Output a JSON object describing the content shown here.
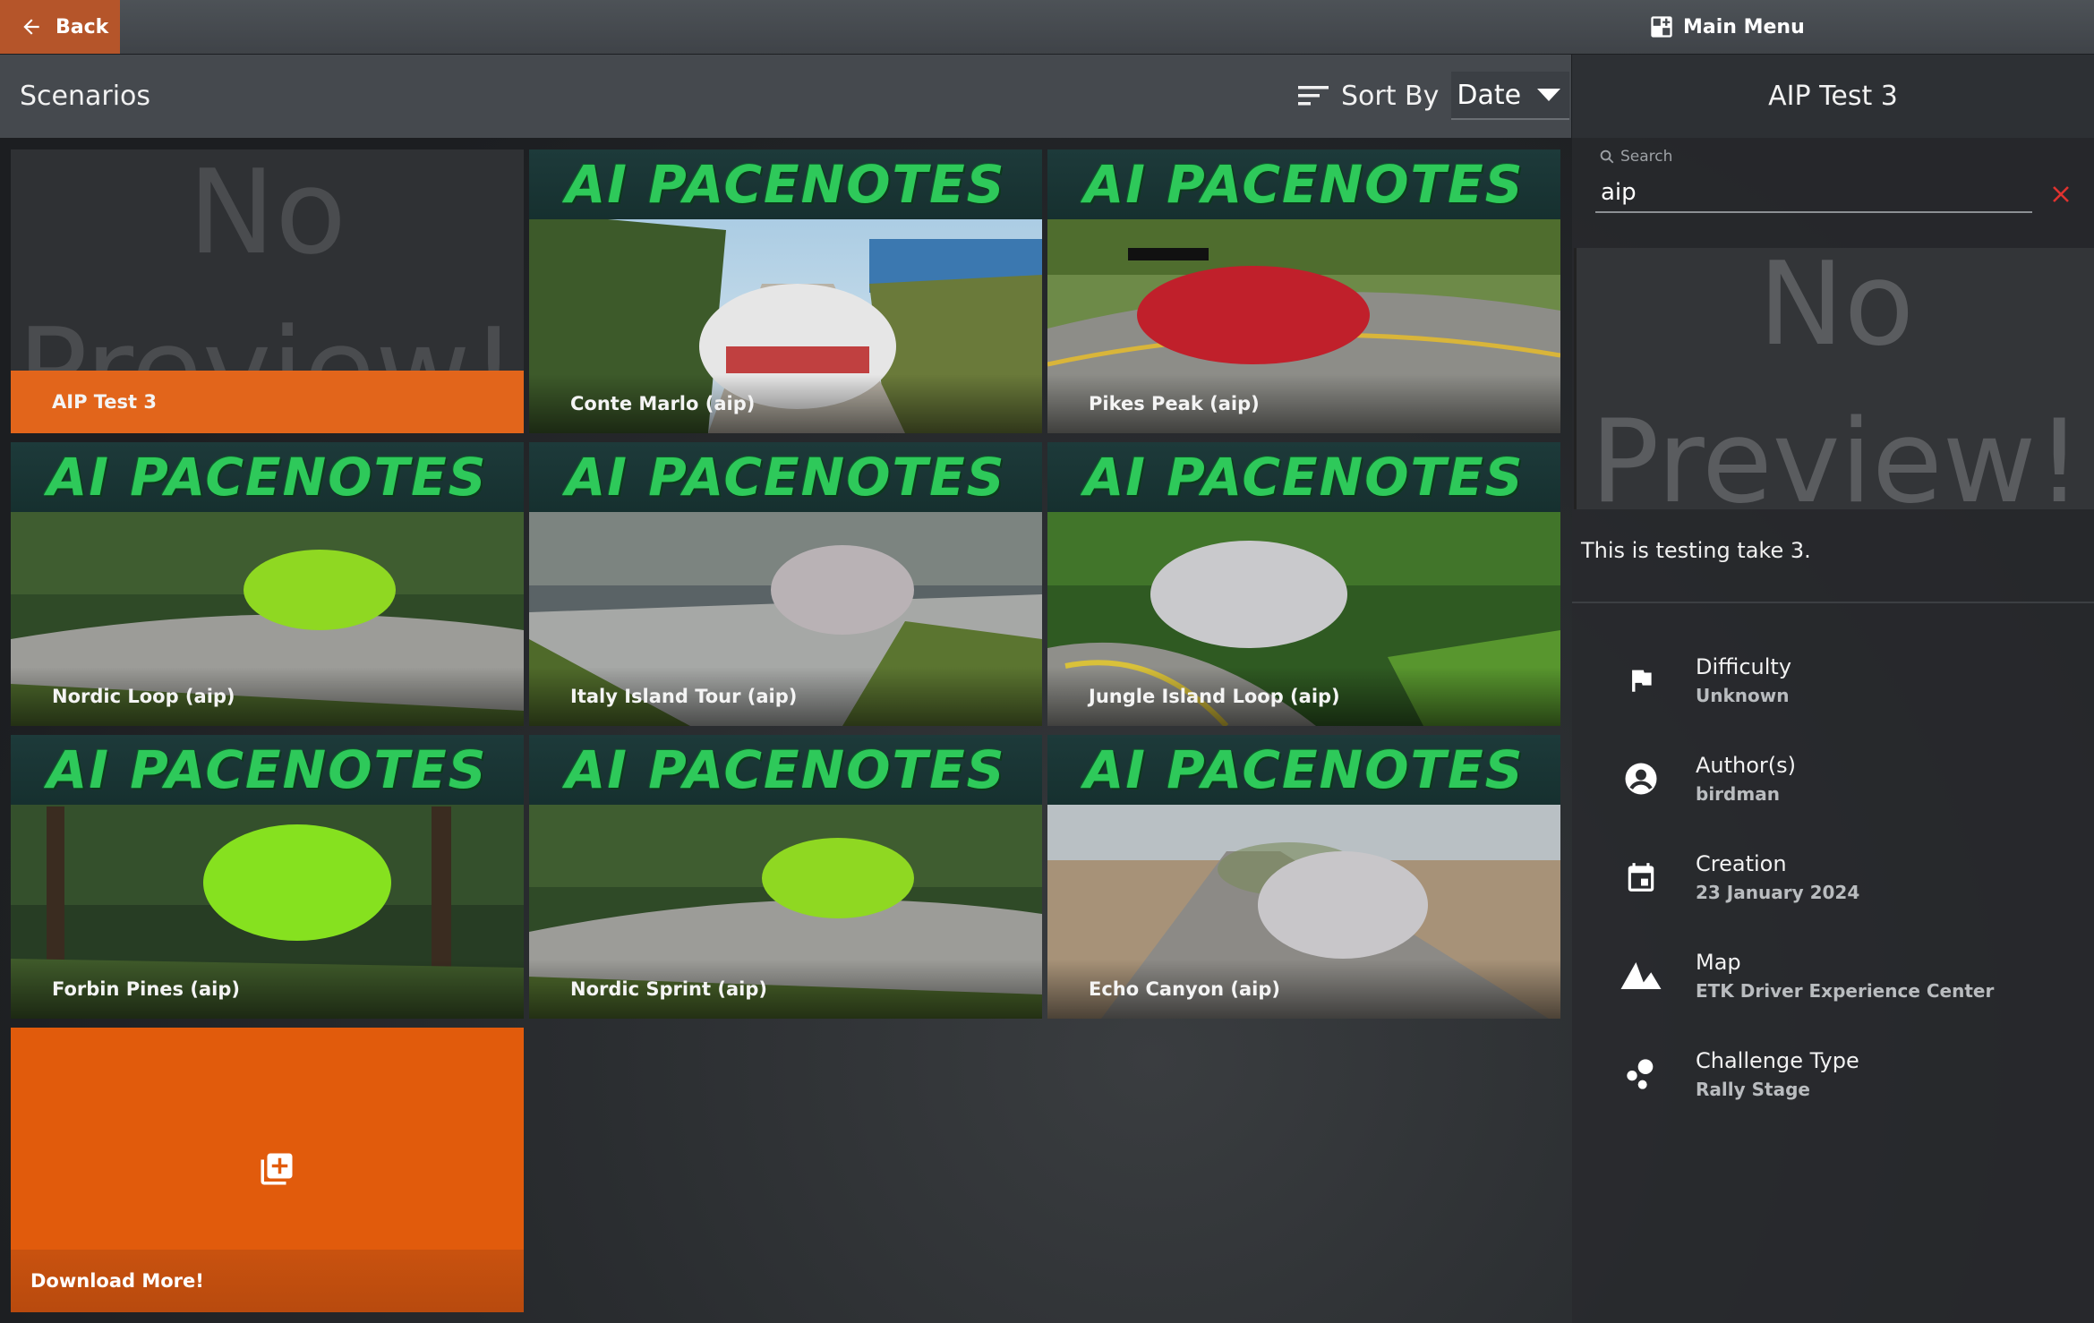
{
  "topbar": {
    "back_label": "Back",
    "main_menu_label": "Main Menu"
  },
  "header": {
    "title": "Scenarios",
    "sort_label": "Sort By",
    "sort_value": "Date"
  },
  "tiles": [
    {
      "label": "AIP Test 3",
      "banner": "",
      "nopreview_1": "No",
      "nopreview_2": "Preview!"
    },
    {
      "label": "Conte Marlo (aip)",
      "banner": "AI PACENOTES"
    },
    {
      "label": "Pikes Peak (aip)",
      "banner": "AI PACENOTES"
    },
    {
      "label": "Nordic Loop (aip)",
      "banner": "AI PACENOTES"
    },
    {
      "label": "Italy Island Tour (aip)",
      "banner": "AI PACENOTES"
    },
    {
      "label": "Jungle Island Loop (aip)",
      "banner": "AI PACENOTES"
    },
    {
      "label": "Forbin Pines (aip)",
      "banner": "AI PACENOTES"
    },
    {
      "label": "Nordic Sprint (aip)",
      "banner": "AI PACENOTES"
    },
    {
      "label": "Echo Canyon (aip)",
      "banner": "AI PACENOTES"
    }
  ],
  "download": {
    "label": "Download More!"
  },
  "panel": {
    "title": "AIP Test 3",
    "search_label": "Search",
    "search_value": "aip",
    "preview_1": "No",
    "preview_2": "Preview!",
    "description": "This is testing take 3.",
    "info": [
      {
        "key": "Difficulty",
        "value": "Unknown",
        "icon": "flag-icon"
      },
      {
        "key": "Author(s)",
        "value": "birdman",
        "icon": "account-icon"
      },
      {
        "key": "Creation",
        "value": "23 January 2024",
        "icon": "calendar-icon"
      },
      {
        "key": "Map",
        "value": "ETK Driver Experience Center",
        "icon": "mountain-icon"
      },
      {
        "key": "Challenge Type",
        "value": "Rally Stage",
        "icon": "dots-icon"
      }
    ]
  },
  "colors": {
    "accent": "#e2651b",
    "banner_text": "#2ec95a",
    "clear": "#e0322f"
  }
}
